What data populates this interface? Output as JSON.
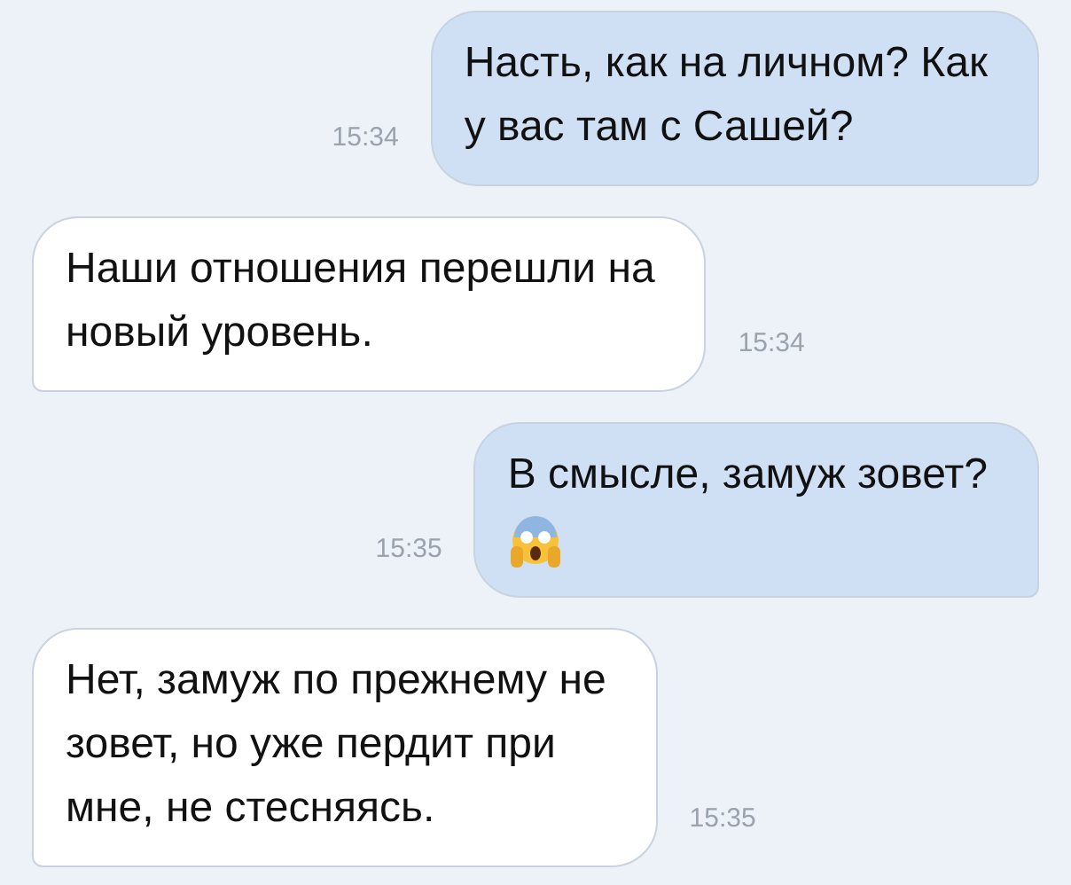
{
  "messages": [
    {
      "kind": "outgoing",
      "text": "Насть, как на личном? Как\nу вас там с Сашей?",
      "time": "15:34"
    },
    {
      "kind": "incoming",
      "text": "Наши отношения перешли на\nновый уровень.",
      "time": "15:34"
    },
    {
      "kind": "outgoing",
      "text": "В смысле, замуж зовет?",
      "time": "15:35",
      "emoji": {
        "kind": "scream"
      }
    },
    {
      "kind": "incoming",
      "text": "Нет, замуж по прежнему не\nзовет, но уже пердит при\nмне, не стесняясь.",
      "time": "15:35"
    }
  ]
}
